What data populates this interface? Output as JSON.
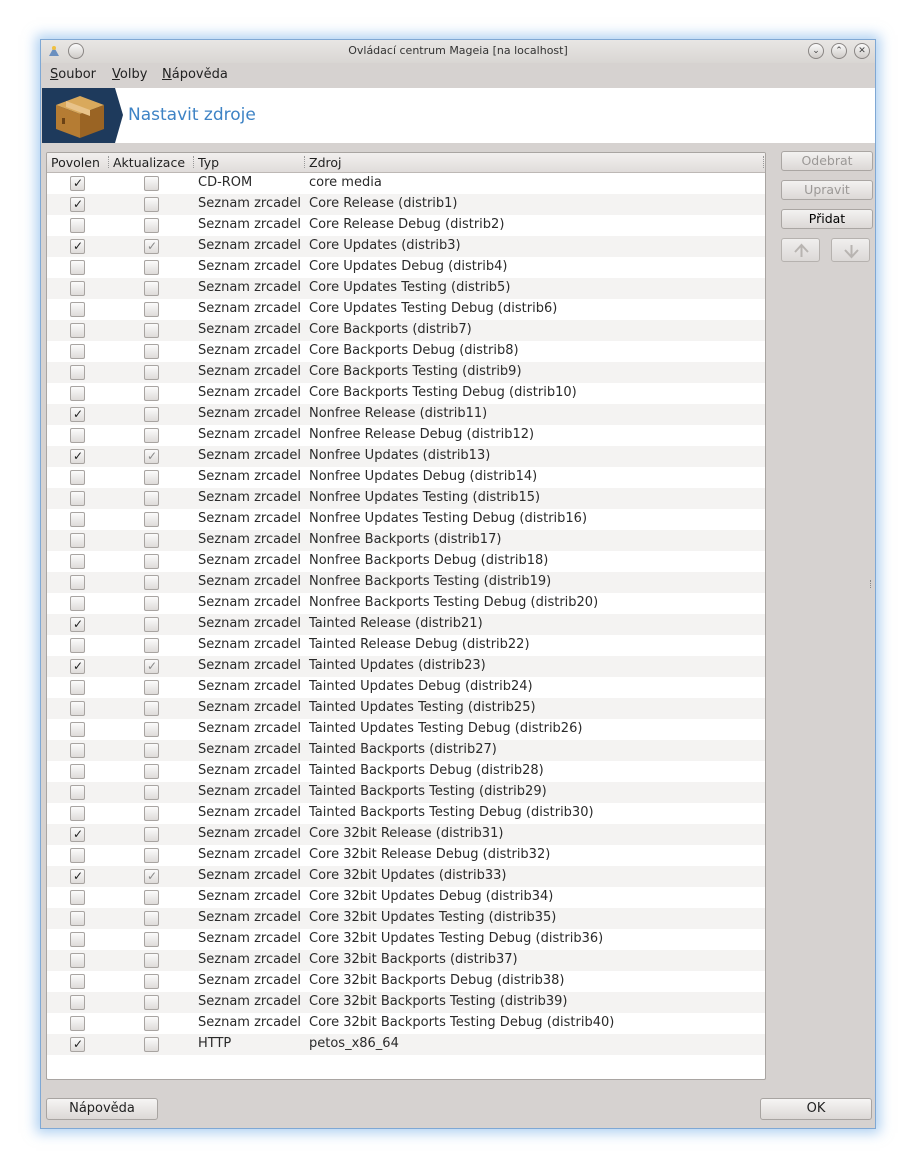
{
  "window": {
    "title": "Ovládací centrum Mageia  [na localhost]"
  },
  "menu": {
    "items": [
      {
        "label": "Soubor",
        "mnemonic": "S",
        "rest": "oubor"
      },
      {
        "label": "Volby",
        "mnemonic": "V",
        "rest": "olby"
      },
      {
        "label": "Nápověda",
        "mnemonic": "N",
        "rest": "ápověda"
      }
    ]
  },
  "banner": {
    "title": "Nastavit zdroje",
    "icon": "package-box-icon"
  },
  "table": {
    "columns": [
      "Povolen",
      "Aktualizace",
      "Typ",
      "Zdroj"
    ],
    "rows": [
      {
        "enabled": true,
        "update": false,
        "type": "CD-ROM",
        "source": "core media"
      },
      {
        "enabled": true,
        "update": false,
        "type": "Seznam zrcadel",
        "source": "Core Release (distrib1)"
      },
      {
        "enabled": false,
        "update": false,
        "type": "Seznam zrcadel",
        "source": "Core Release Debug (distrib2)"
      },
      {
        "enabled": true,
        "update": true,
        "type": "Seznam zrcadel",
        "source": "Core Updates (distrib3)"
      },
      {
        "enabled": false,
        "update": false,
        "type": "Seznam zrcadel",
        "source": "Core Updates Debug (distrib4)"
      },
      {
        "enabled": false,
        "update": false,
        "type": "Seznam zrcadel",
        "source": "Core Updates Testing (distrib5)"
      },
      {
        "enabled": false,
        "update": false,
        "type": "Seznam zrcadel",
        "source": "Core Updates Testing Debug (distrib6)"
      },
      {
        "enabled": false,
        "update": false,
        "type": "Seznam zrcadel",
        "source": "Core Backports (distrib7)"
      },
      {
        "enabled": false,
        "update": false,
        "type": "Seznam zrcadel",
        "source": "Core Backports Debug (distrib8)"
      },
      {
        "enabled": false,
        "update": false,
        "type": "Seznam zrcadel",
        "source": "Core Backports Testing (distrib9)"
      },
      {
        "enabled": false,
        "update": false,
        "type": "Seznam zrcadel",
        "source": "Core Backports Testing Debug (distrib10)"
      },
      {
        "enabled": true,
        "update": false,
        "type": "Seznam zrcadel",
        "source": "Nonfree Release (distrib11)"
      },
      {
        "enabled": false,
        "update": false,
        "type": "Seznam zrcadel",
        "source": "Nonfree Release Debug (distrib12)"
      },
      {
        "enabled": true,
        "update": true,
        "type": "Seznam zrcadel",
        "source": "Nonfree Updates (distrib13)"
      },
      {
        "enabled": false,
        "update": false,
        "type": "Seznam zrcadel",
        "source": "Nonfree Updates Debug (distrib14)"
      },
      {
        "enabled": false,
        "update": false,
        "type": "Seznam zrcadel",
        "source": "Nonfree Updates Testing (distrib15)"
      },
      {
        "enabled": false,
        "update": false,
        "type": "Seznam zrcadel",
        "source": "Nonfree Updates Testing Debug (distrib16)"
      },
      {
        "enabled": false,
        "update": false,
        "type": "Seznam zrcadel",
        "source": "Nonfree Backports (distrib17)"
      },
      {
        "enabled": false,
        "update": false,
        "type": "Seznam zrcadel",
        "source": "Nonfree Backports Debug (distrib18)"
      },
      {
        "enabled": false,
        "update": false,
        "type": "Seznam zrcadel",
        "source": "Nonfree Backports Testing (distrib19)"
      },
      {
        "enabled": false,
        "update": false,
        "type": "Seznam zrcadel",
        "source": "Nonfree Backports Testing Debug (distrib20)"
      },
      {
        "enabled": true,
        "update": false,
        "type": "Seznam zrcadel",
        "source": "Tainted Release (distrib21)"
      },
      {
        "enabled": false,
        "update": false,
        "type": "Seznam zrcadel",
        "source": "Tainted Release Debug (distrib22)"
      },
      {
        "enabled": true,
        "update": true,
        "type": "Seznam zrcadel",
        "source": "Tainted Updates (distrib23)"
      },
      {
        "enabled": false,
        "update": false,
        "type": "Seznam zrcadel",
        "source": "Tainted Updates Debug (distrib24)"
      },
      {
        "enabled": false,
        "update": false,
        "type": "Seznam zrcadel",
        "source": "Tainted Updates Testing (distrib25)"
      },
      {
        "enabled": false,
        "update": false,
        "type": "Seznam zrcadel",
        "source": "Tainted Updates Testing Debug (distrib26)"
      },
      {
        "enabled": false,
        "update": false,
        "type": "Seznam zrcadel",
        "source": "Tainted Backports (distrib27)"
      },
      {
        "enabled": false,
        "update": false,
        "type": "Seznam zrcadel",
        "source": "Tainted Backports Debug (distrib28)"
      },
      {
        "enabled": false,
        "update": false,
        "type": "Seznam zrcadel",
        "source": "Tainted Backports Testing (distrib29)"
      },
      {
        "enabled": false,
        "update": false,
        "type": "Seznam zrcadel",
        "source": "Tainted Backports Testing Debug (distrib30)"
      },
      {
        "enabled": true,
        "update": false,
        "type": "Seznam zrcadel",
        "source": "Core 32bit Release (distrib31)"
      },
      {
        "enabled": false,
        "update": false,
        "type": "Seznam zrcadel",
        "source": "Core 32bit Release Debug (distrib32)"
      },
      {
        "enabled": true,
        "update": true,
        "type": "Seznam zrcadel",
        "source": "Core 32bit Updates (distrib33)"
      },
      {
        "enabled": false,
        "update": false,
        "type": "Seznam zrcadel",
        "source": "Core 32bit Updates Debug (distrib34)"
      },
      {
        "enabled": false,
        "update": false,
        "type": "Seznam zrcadel",
        "source": "Core 32bit Updates Testing (distrib35)"
      },
      {
        "enabled": false,
        "update": false,
        "type": "Seznam zrcadel",
        "source": "Core 32bit Updates Testing Debug (distrib36)"
      },
      {
        "enabled": false,
        "update": false,
        "type": "Seznam zrcadel",
        "source": "Core 32bit Backports (distrib37)"
      },
      {
        "enabled": false,
        "update": false,
        "type": "Seznam zrcadel",
        "source": "Core 32bit Backports Debug (distrib38)"
      },
      {
        "enabled": false,
        "update": false,
        "type": "Seznam zrcadel",
        "source": "Core 32bit Backports Testing (distrib39)"
      },
      {
        "enabled": false,
        "update": false,
        "type": "Seznam zrcadel",
        "source": "Core 32bit Backports Testing Debug (distrib40)"
      },
      {
        "enabled": true,
        "update": false,
        "type": "HTTP",
        "source": "petos_x86_64"
      }
    ]
  },
  "side_buttons": {
    "remove": "Odebrat",
    "edit": "Upravit",
    "add": "Přidat",
    "up_icon": "arrow-up-icon",
    "down_icon": "arrow-down-icon"
  },
  "bottom_buttons": {
    "help": "Nápověda",
    "ok": "OK"
  },
  "colors": {
    "accent": "#3e83c5",
    "window_bg": "#d6d2d0",
    "checkmark": "#222222",
    "checkmark_disabled": "#8a8a8a"
  }
}
